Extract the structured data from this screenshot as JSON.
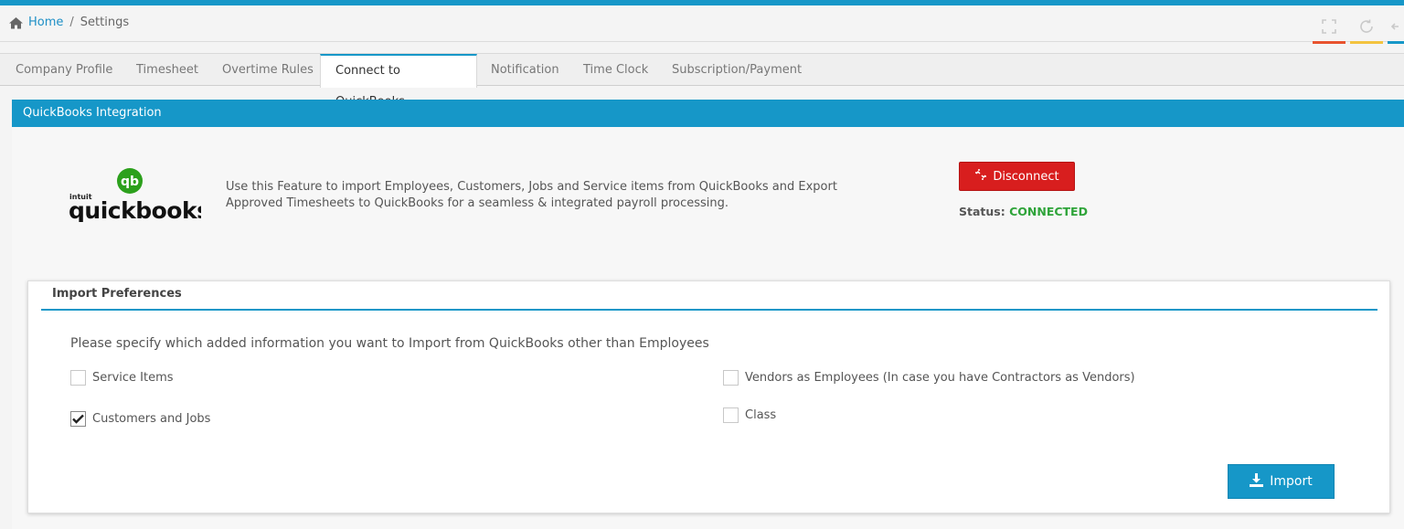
{
  "breadcrumb": {
    "home": "Home",
    "separator": "/",
    "current": "Settings"
  },
  "toolbar": {
    "icons": [
      "fullscreen-icon",
      "refresh-icon",
      "collapse-icon"
    ],
    "accent_colors": [
      "#e8532e",
      "#f3c33f",
      "#1697c8"
    ]
  },
  "tabs": [
    {
      "label": "Company Profile"
    },
    {
      "label": "Timesheet"
    },
    {
      "label": "Overtime Rules"
    },
    {
      "label": "Connect to QuickBooks",
      "active": true
    },
    {
      "label": "Notification"
    },
    {
      "label": "Time Clock"
    },
    {
      "label": "Subscription/Payment"
    }
  ],
  "panel": {
    "title": "QuickBooks Integration",
    "logo": {
      "small": "intuit",
      "brand": "quickbooks",
      "badge": "qb"
    },
    "description": "Use this Feature to import Employees, Customers, Jobs and Service items from QuickBooks and Export Approved Timesheets to QuickBooks for a seamless & integrated payroll processing.",
    "disconnect_label": "Disconnect",
    "status_label": "Status:",
    "status_value": "CONNECTED"
  },
  "import_prefs": {
    "title": "Import Preferences",
    "question": "Please specify which added information you want to Import from QuickBooks other than Employees",
    "options": [
      {
        "label": "Service Items",
        "checked": false
      },
      {
        "label": "Customers and Jobs",
        "checked": true
      },
      {
        "label": "Vendors as Employees (In case you have Contractors as Vendors)",
        "checked": false
      },
      {
        "label": "Class",
        "checked": false
      }
    ],
    "import_label": "Import"
  },
  "colors": {
    "accent": "#1697c8",
    "danger": "#d81e1e",
    "success": "#2fa43a",
    "qb_green": "#2ca01c"
  }
}
